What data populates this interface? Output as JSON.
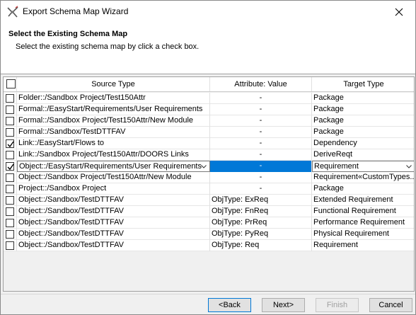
{
  "window": {
    "title": "Export Schema Map Wizard",
    "accent": "#0078d7"
  },
  "header": {
    "title": "Select the Existing Schema Map",
    "description": "Select the existing schema map by click a check box."
  },
  "grid": {
    "columns": {
      "source": "Source Type",
      "attribute": "Attribute: Value",
      "target": "Target Type"
    },
    "rows": [
      {
        "checked": false,
        "source": "Folder::/Sandbox Project/Test150Attr",
        "attribute": "-",
        "target": "Package"
      },
      {
        "checked": false,
        "source": "Formal::/EasyStart/Requirements/User Requirements",
        "attribute": "-",
        "target": "Package"
      },
      {
        "checked": false,
        "source": "Formal::/Sandbox Project/Test150Attr/New Module",
        "attribute": "-",
        "target": "Package"
      },
      {
        "checked": false,
        "source": "Formal::/Sandbox/TestDTTFAV",
        "attribute": "-",
        "target": "Package"
      },
      {
        "checked": true,
        "source": "Link::/EasyStart/Flows to",
        "attribute": "-",
        "target": "Dependency"
      },
      {
        "checked": false,
        "source": "Link::/Sandbox Project/Test150Attr/DOORS Links",
        "attribute": "-",
        "target": "DeriveReqt"
      },
      {
        "checked": true,
        "source": "Object::/EasyStart/Requirements/User Requirements",
        "attribute": "-",
        "target": "Requirement",
        "selected": true
      },
      {
        "checked": false,
        "source": "Object::/Sandbox Project/Test150Attr/New Module",
        "attribute": "-",
        "target": "Requirement«CustomTypes..."
      },
      {
        "checked": false,
        "source": "Project::/Sandbox Project",
        "attribute": "-",
        "target": "Package"
      },
      {
        "checked": false,
        "source": "Object::/Sandbox/TestDTTFAV",
        "attribute": "ObjType: ExReq",
        "target": "Extended Requirement"
      },
      {
        "checked": false,
        "source": "Object::/Sandbox/TestDTTFAV",
        "attribute": "ObjType: FnReq",
        "target": "Functional Requirement"
      },
      {
        "checked": false,
        "source": "Object::/Sandbox/TestDTTFAV",
        "attribute": "ObjType: PrReq",
        "target": "Performance Requirement"
      },
      {
        "checked": false,
        "source": "Object::/Sandbox/TestDTTFAV",
        "attribute": "ObjType: PyReq",
        "target": "Physical Requirement"
      },
      {
        "checked": false,
        "source": "Object::/Sandbox/TestDTTFAV",
        "attribute": "ObjType: Req",
        "target": "Requirement"
      }
    ]
  },
  "buttons": {
    "back": "<Back",
    "next": "Next>",
    "finish": "Finish",
    "cancel": "Cancel"
  }
}
